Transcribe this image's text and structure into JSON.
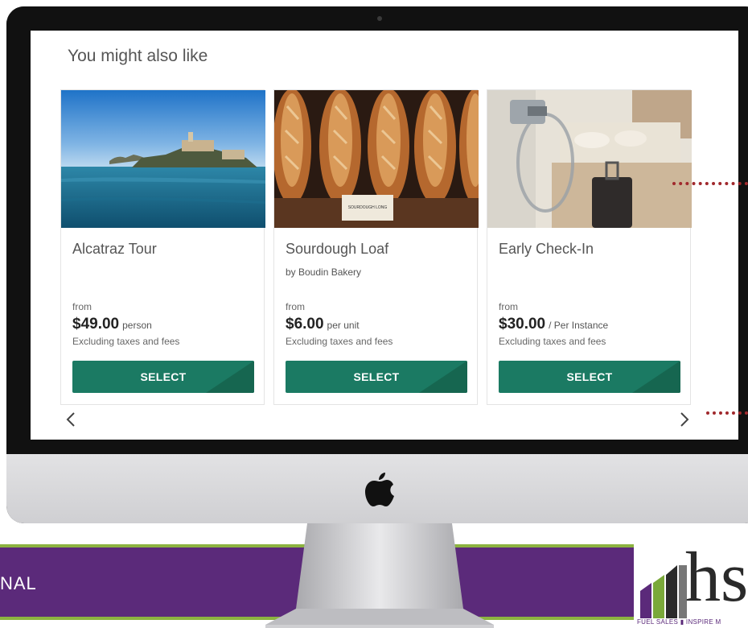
{
  "screen": {
    "section_title": "You might also like",
    "cards": [
      {
        "title": "Alcatraz Tour",
        "subtitle": "",
        "from_label": "from",
        "price": "$49.00",
        "unit": "person",
        "note": "Excluding taxes and fees",
        "button_label": "SELECT"
      },
      {
        "title": "Sourdough Loaf",
        "subtitle": "by Boudin Bakery",
        "from_label": "from",
        "price": "$6.00",
        "unit": "per unit",
        "note": "Excluding taxes and fees",
        "button_label": "SELECT"
      },
      {
        "title": "Early Check-In",
        "subtitle": "",
        "from_label": "from",
        "price": "$30.00",
        "unit": "/ Per Instance",
        "note": "Excluding taxes and fees",
        "button_label": "SELECT"
      }
    ],
    "prev_icon": "chevron-left-icon",
    "next_icon": "chevron-right-icon",
    "bread_sign": "SOURDOUGH LONG"
  },
  "banner": {
    "text": "NAL",
    "logo_letters": "hs",
    "logo_tagline": "FUEL SALES ▮ INSPIRE M"
  },
  "colors": {
    "button": "#1b7a63",
    "banner": "#5b2a7a",
    "banner_stripe": "#8cb340",
    "annotation": "#a0282c"
  }
}
